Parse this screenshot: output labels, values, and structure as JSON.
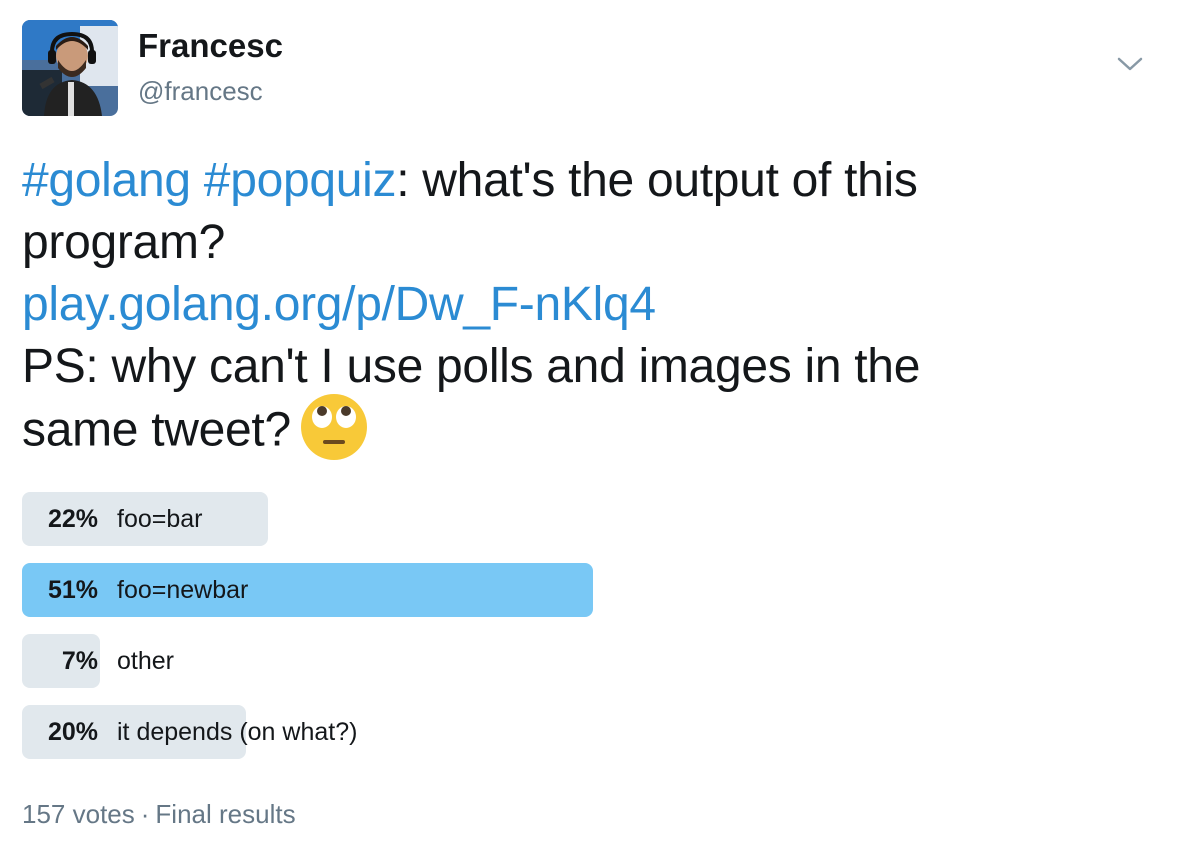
{
  "user": {
    "display_name": "Francesc",
    "handle": "@francesc",
    "avatar_icon": "avatar-photo"
  },
  "menu": {
    "icon": "chevron-down-icon"
  },
  "tweet": {
    "hashtag1": "#golang",
    "hashtag2": "#popquiz",
    "text_part1": ": what's the output of this",
    "text_part2": "program?",
    "link": "play.golang.org/p/Dw_F-nKlq4",
    "text_part3": "PS: why can't I use polls and images in the",
    "text_part4": "same tweet?",
    "emoji": "face-with-rolling-eyes"
  },
  "poll": {
    "options": [
      {
        "percent": "22%",
        "label": "foo=bar",
        "value": 22,
        "winner": false
      },
      {
        "percent": "51%",
        "label": "foo=newbar",
        "value": 51,
        "winner": true
      },
      {
        "percent": "7%",
        "label": "other",
        "value": 7,
        "winner": false
      },
      {
        "percent": "20%",
        "label": "it depends (on what?)",
        "value": 20,
        "winner": false
      }
    ],
    "votes": "157 votes",
    "status": "Final results"
  },
  "colors": {
    "link": "#2b8bd3",
    "bar": "#e1e8ed",
    "winner_bar": "#79c8f5",
    "muted": "#657786"
  }
}
